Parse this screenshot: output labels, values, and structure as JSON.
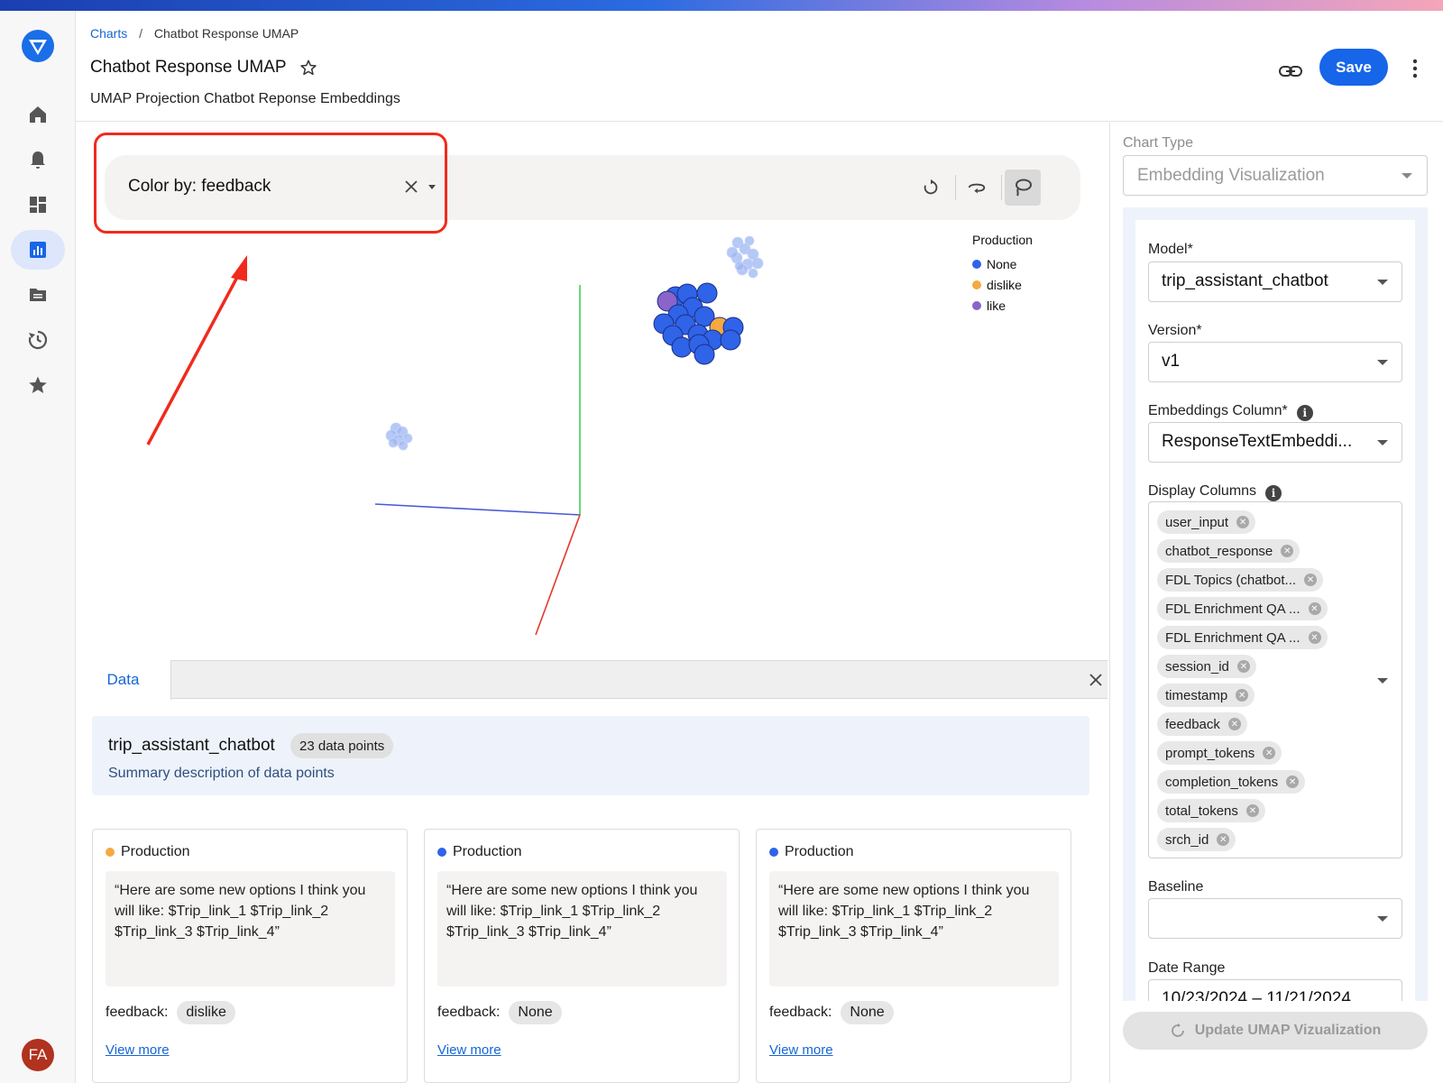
{
  "breadcrumb": {
    "root": "Charts",
    "separator": "/",
    "current": "Chatbot Response UMAP"
  },
  "header": {
    "title": "Chatbot Response UMAP",
    "subtitle": "UMAP Projection Chatbot Reponse Embeddings",
    "save_label": "Save"
  },
  "sidebar_nav": {
    "icons": [
      "home-icon",
      "bell-icon",
      "dashboard-icon",
      "chart-icon",
      "folder-icon",
      "history-icon",
      "star-icon"
    ],
    "active": "chart-icon",
    "avatar_initials": "FA"
  },
  "toolbar": {
    "color_by_label": "Color by: feedback"
  },
  "legend": {
    "title": "Production",
    "items": [
      {
        "label": "None",
        "color": "#2f63e8"
      },
      {
        "label": "dislike",
        "color": "#f5a940"
      },
      {
        "label": "like",
        "color": "#8a64c8"
      }
    ]
  },
  "data_panel": {
    "tab_label": "Data",
    "model_name": "trip_assistant_chatbot",
    "count_label": "23 data points",
    "summary_desc": "Summary description of data points",
    "cards": [
      {
        "env": "Production",
        "dot_color": "#f5a940",
        "quote": "“Here are some new options I think you will like: $Trip_link_1 $Trip_link_2 $Trip_link_3 $Trip_link_4”",
        "feedback_label": "feedback:",
        "feedback_value": "dislike",
        "view_more": "View more"
      },
      {
        "env": "Production",
        "dot_color": "#2f63e8",
        "quote": "“Here are some new options I think you will like: $Trip_link_1 $Trip_link_2 $Trip_link_3 $Trip_link_4”",
        "feedback_label": "feedback:",
        "feedback_value": "None",
        "view_more": "View more"
      },
      {
        "env": "Production",
        "dot_color": "#2f63e8",
        "quote": "“Here are some new options I think you will like: $Trip_link_1 $Trip_link_2 $Trip_link_3 $Trip_link_4”",
        "feedback_label": "feedback:",
        "feedback_value": "None",
        "view_more": "View more"
      }
    ]
  },
  "config": {
    "chart_type_label": "Chart Type",
    "chart_type_value": "Embedding Visualization",
    "model_label": "Model*",
    "model_value": "trip_assistant_chatbot",
    "version_label": "Version*",
    "version_value": "v1",
    "embeddings_label": "Embeddings Column*",
    "embeddings_value": "ResponseTextEmbeddi...",
    "display_columns_label": "Display Columns",
    "display_columns": [
      "user_input",
      "chatbot_response",
      "FDL Topics (chatbot...",
      "FDL Enrichment QA ...",
      "FDL Enrichment QA ...",
      "session_id",
      "timestamp",
      "feedback",
      "prompt_tokens",
      "completion_tokens",
      "total_tokens",
      "srch_id"
    ],
    "baseline_label": "Baseline",
    "baseline_value": "",
    "date_range_label": "Date Range",
    "date_range_value": "10/23/2024 – 11/21/2024",
    "update_label": "Update UMAP Vizualization"
  }
}
